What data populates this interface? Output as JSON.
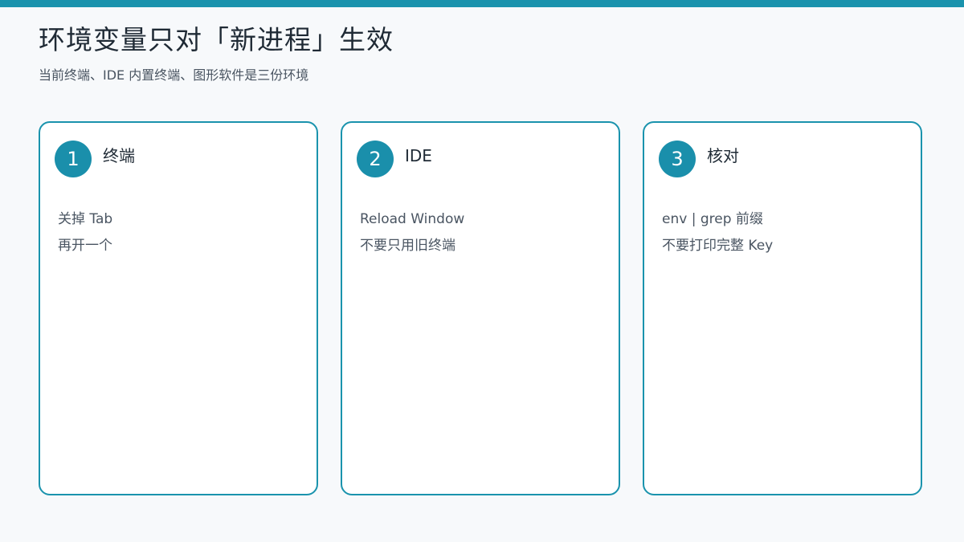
{
  "page": {
    "title": "环境变量只对「新进程」生效",
    "subtitle": "当前终端、IDE 内置终端、图形软件是三份环境",
    "accent_color": "#1a93ad"
  },
  "cards": [
    {
      "number": "1",
      "title": "终端",
      "lines": [
        "关掉 Tab",
        "再开一个"
      ]
    },
    {
      "number": "2",
      "title": "IDE",
      "lines": [
        "Reload Window",
        "不要只用旧终端"
      ]
    },
    {
      "number": "3",
      "title": "核对",
      "lines": [
        "env | grep 前缀",
        "不要打印完整 Key"
      ]
    }
  ]
}
